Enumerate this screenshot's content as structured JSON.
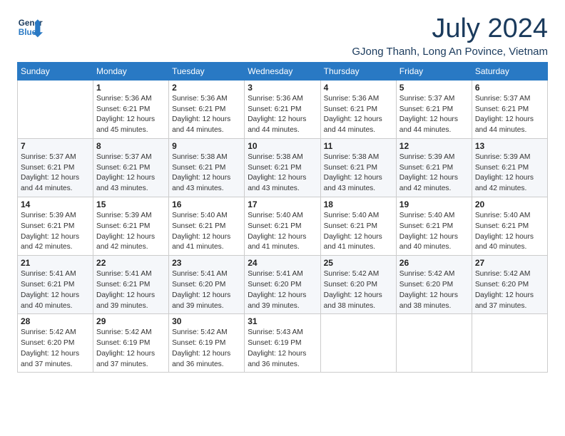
{
  "header": {
    "logo_line1": "General",
    "logo_line2": "Blue",
    "month_year": "July 2024",
    "location": "GJong Thanh, Long An Povince, Vietnam"
  },
  "weekdays": [
    "Sunday",
    "Monday",
    "Tuesday",
    "Wednesday",
    "Thursday",
    "Friday",
    "Saturday"
  ],
  "weeks": [
    [
      {
        "day": "",
        "text": ""
      },
      {
        "day": "1",
        "text": "Sunrise: 5:36 AM\nSunset: 6:21 PM\nDaylight: 12 hours\nand 45 minutes."
      },
      {
        "day": "2",
        "text": "Sunrise: 5:36 AM\nSunset: 6:21 PM\nDaylight: 12 hours\nand 44 minutes."
      },
      {
        "day": "3",
        "text": "Sunrise: 5:36 AM\nSunset: 6:21 PM\nDaylight: 12 hours\nand 44 minutes."
      },
      {
        "day": "4",
        "text": "Sunrise: 5:36 AM\nSunset: 6:21 PM\nDaylight: 12 hours\nand 44 minutes."
      },
      {
        "day": "5",
        "text": "Sunrise: 5:37 AM\nSunset: 6:21 PM\nDaylight: 12 hours\nand 44 minutes."
      },
      {
        "day": "6",
        "text": "Sunrise: 5:37 AM\nSunset: 6:21 PM\nDaylight: 12 hours\nand 44 minutes."
      }
    ],
    [
      {
        "day": "7",
        "text": "Sunrise: 5:37 AM\nSunset: 6:21 PM\nDaylight: 12 hours\nand 44 minutes."
      },
      {
        "day": "8",
        "text": "Sunrise: 5:37 AM\nSunset: 6:21 PM\nDaylight: 12 hours\nand 43 minutes."
      },
      {
        "day": "9",
        "text": "Sunrise: 5:38 AM\nSunset: 6:21 PM\nDaylight: 12 hours\nand 43 minutes."
      },
      {
        "day": "10",
        "text": "Sunrise: 5:38 AM\nSunset: 6:21 PM\nDaylight: 12 hours\nand 43 minutes."
      },
      {
        "day": "11",
        "text": "Sunrise: 5:38 AM\nSunset: 6:21 PM\nDaylight: 12 hours\nand 43 minutes."
      },
      {
        "day": "12",
        "text": "Sunrise: 5:39 AM\nSunset: 6:21 PM\nDaylight: 12 hours\nand 42 minutes."
      },
      {
        "day": "13",
        "text": "Sunrise: 5:39 AM\nSunset: 6:21 PM\nDaylight: 12 hours\nand 42 minutes."
      }
    ],
    [
      {
        "day": "14",
        "text": "Sunrise: 5:39 AM\nSunset: 6:21 PM\nDaylight: 12 hours\nand 42 minutes."
      },
      {
        "day": "15",
        "text": "Sunrise: 5:39 AM\nSunset: 6:21 PM\nDaylight: 12 hours\nand 42 minutes."
      },
      {
        "day": "16",
        "text": "Sunrise: 5:40 AM\nSunset: 6:21 PM\nDaylight: 12 hours\nand 41 minutes."
      },
      {
        "day": "17",
        "text": "Sunrise: 5:40 AM\nSunset: 6:21 PM\nDaylight: 12 hours\nand 41 minutes."
      },
      {
        "day": "18",
        "text": "Sunrise: 5:40 AM\nSunset: 6:21 PM\nDaylight: 12 hours\nand 41 minutes."
      },
      {
        "day": "19",
        "text": "Sunrise: 5:40 AM\nSunset: 6:21 PM\nDaylight: 12 hours\nand 40 minutes."
      },
      {
        "day": "20",
        "text": "Sunrise: 5:40 AM\nSunset: 6:21 PM\nDaylight: 12 hours\nand 40 minutes."
      }
    ],
    [
      {
        "day": "21",
        "text": "Sunrise: 5:41 AM\nSunset: 6:21 PM\nDaylight: 12 hours\nand 40 minutes."
      },
      {
        "day": "22",
        "text": "Sunrise: 5:41 AM\nSunset: 6:21 PM\nDaylight: 12 hours\nand 39 minutes."
      },
      {
        "day": "23",
        "text": "Sunrise: 5:41 AM\nSunset: 6:20 PM\nDaylight: 12 hours\nand 39 minutes."
      },
      {
        "day": "24",
        "text": "Sunrise: 5:41 AM\nSunset: 6:20 PM\nDaylight: 12 hours\nand 39 minutes."
      },
      {
        "day": "25",
        "text": "Sunrise: 5:42 AM\nSunset: 6:20 PM\nDaylight: 12 hours\nand 38 minutes."
      },
      {
        "day": "26",
        "text": "Sunrise: 5:42 AM\nSunset: 6:20 PM\nDaylight: 12 hours\nand 38 minutes."
      },
      {
        "day": "27",
        "text": "Sunrise: 5:42 AM\nSunset: 6:20 PM\nDaylight: 12 hours\nand 37 minutes."
      }
    ],
    [
      {
        "day": "28",
        "text": "Sunrise: 5:42 AM\nSunset: 6:20 PM\nDaylight: 12 hours\nand 37 minutes."
      },
      {
        "day": "29",
        "text": "Sunrise: 5:42 AM\nSunset: 6:19 PM\nDaylight: 12 hours\nand 37 minutes."
      },
      {
        "day": "30",
        "text": "Sunrise: 5:42 AM\nSunset: 6:19 PM\nDaylight: 12 hours\nand 36 minutes."
      },
      {
        "day": "31",
        "text": "Sunrise: 5:43 AM\nSunset: 6:19 PM\nDaylight: 12 hours\nand 36 minutes."
      },
      {
        "day": "",
        "text": ""
      },
      {
        "day": "",
        "text": ""
      },
      {
        "day": "",
        "text": ""
      }
    ]
  ]
}
